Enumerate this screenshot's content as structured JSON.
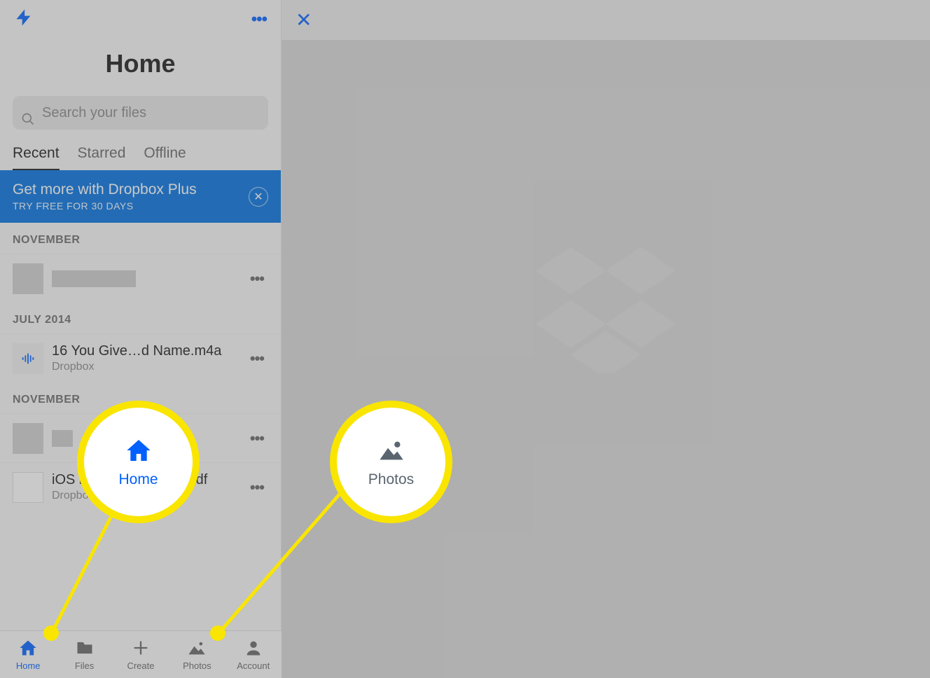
{
  "header": {
    "title": "Home"
  },
  "search": {
    "placeholder": "Search your files"
  },
  "tabs": {
    "recent": "Recent",
    "starred": "Starred",
    "offline": "Offline"
  },
  "promo": {
    "title": "Get more with Dropbox Plus",
    "subtitle": "TRY FREE FOR 30 DAYS"
  },
  "sections": {
    "nov1": "NOVEMBER",
    "jul2014": "JULY 2014",
    "nov2": "NOVEMBER"
  },
  "files": {
    "item1": {
      "name": "",
      "location": ""
    },
    "item2": {
      "name": "16 You Give…d Name.m4a",
      "location": "Dropbox"
    },
    "item3": {
      "name": "",
      "location": ""
    },
    "item4": {
      "name": "iOS ip",
      "suffix": "df",
      "location": "Dropbox"
    }
  },
  "tabbar": {
    "home": "Home",
    "files": "Files",
    "create": "Create",
    "photos": "Photos",
    "account": "Account"
  },
  "callouts": {
    "home": "Home",
    "photos": "Photos"
  }
}
